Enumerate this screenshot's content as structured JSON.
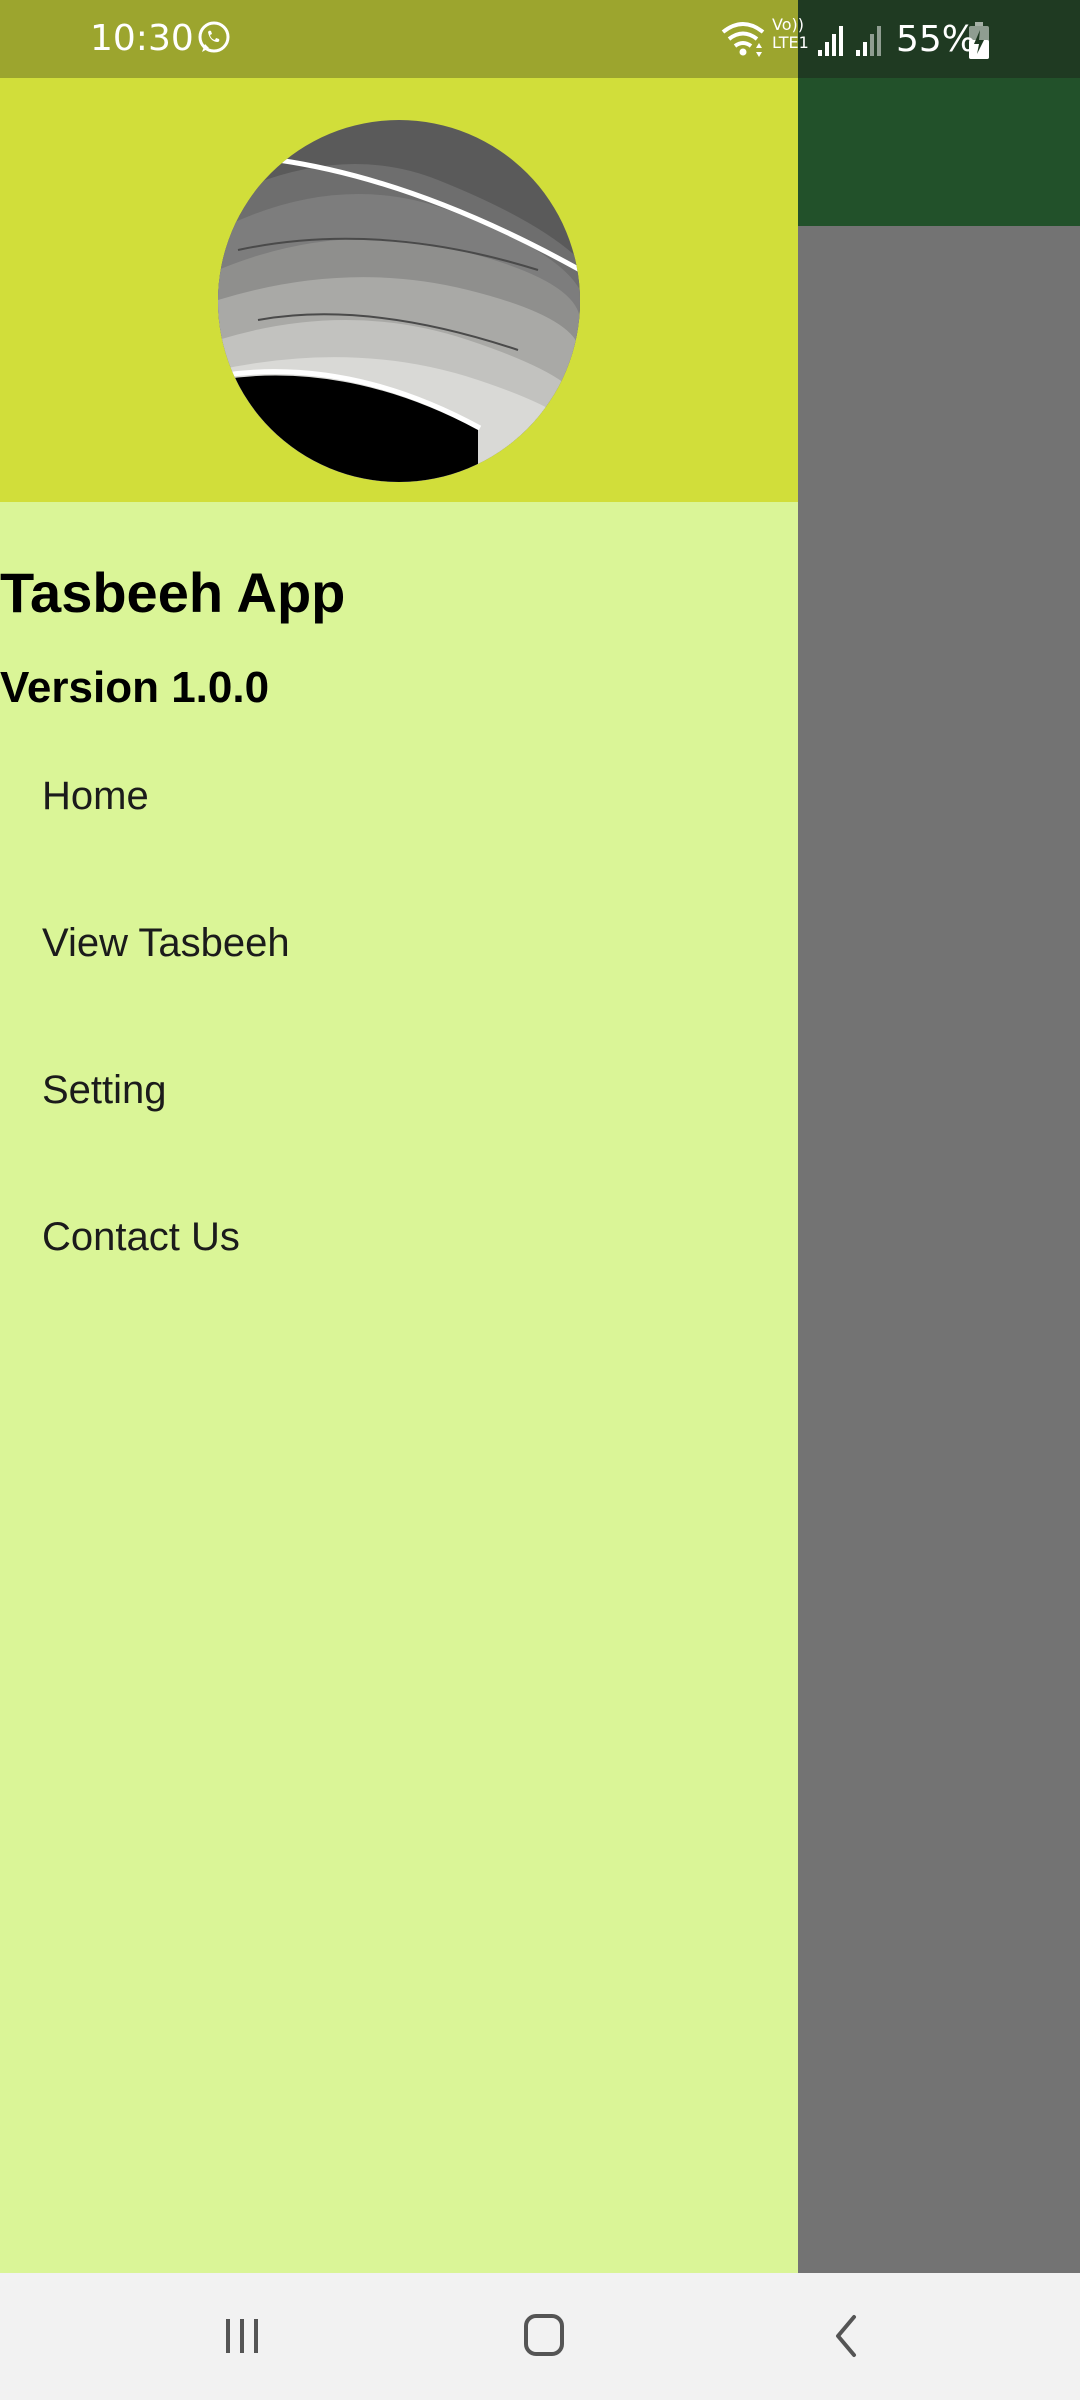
{
  "status_bar": {
    "time": "10:30",
    "volte_top": "Vo))",
    "volte_bottom": "LTE1",
    "battery": "55%"
  },
  "drawer": {
    "title": "Tasbeeh App",
    "version": "Version 1.0.0",
    "items": [
      {
        "label": "Home",
        "icon": "none"
      },
      {
        "label": "View Tasbeeh",
        "icon": "none"
      },
      {
        "label": "Setting",
        "icon": "none"
      },
      {
        "label": "Contact Us",
        "icon": "none"
      }
    ]
  },
  "colors": {
    "status_bar_left": "#9ca52e",
    "status_bar_right": "#1f3a22",
    "app_bar": "#22512a",
    "drawer_header": "#d1de3a",
    "drawer_body": "#daf597",
    "scrim": "#737373",
    "nav_bar": "#f2f2f2"
  },
  "icons": {
    "status": [
      "whatsapp-icon",
      "wifi-icon",
      "signal-icon",
      "signal-icon",
      "battery-charging-icon"
    ],
    "nav": [
      "recents-icon",
      "home-icon",
      "back-icon"
    ]
  }
}
